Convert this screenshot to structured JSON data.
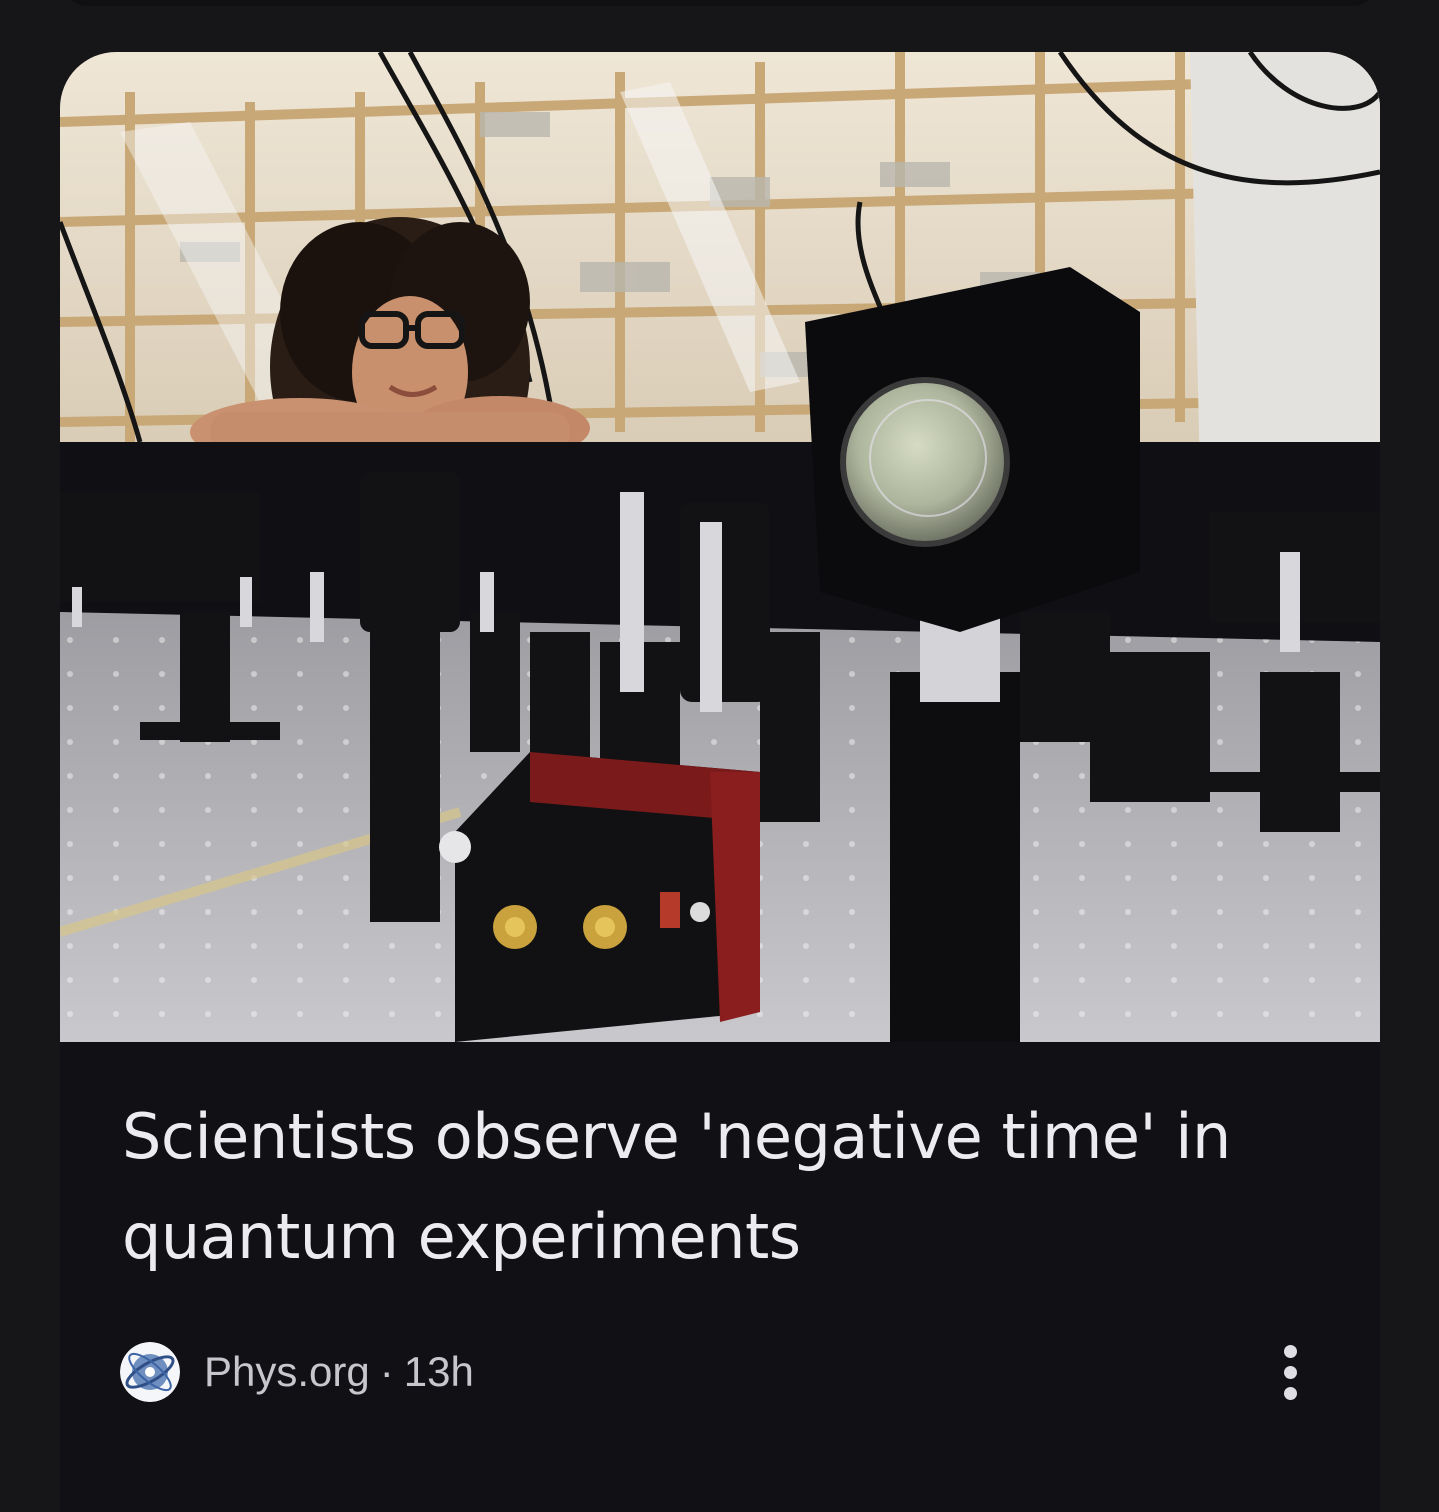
{
  "article": {
    "image_alt": "Scientist leaning on an optical table with laser lab equipment",
    "headline": "Scientists observe 'negative time' in quantum experiments",
    "source": "Phys.org",
    "separator": "·",
    "age": "13h",
    "source_icon": "phys-org-logo-icon",
    "more_icon": "more-vert-icon"
  },
  "colors": {
    "page_bg": "#161618",
    "card_bg": "#101015",
    "headline_text": "#ececf0",
    "meta_text": "#c6c6cc"
  }
}
